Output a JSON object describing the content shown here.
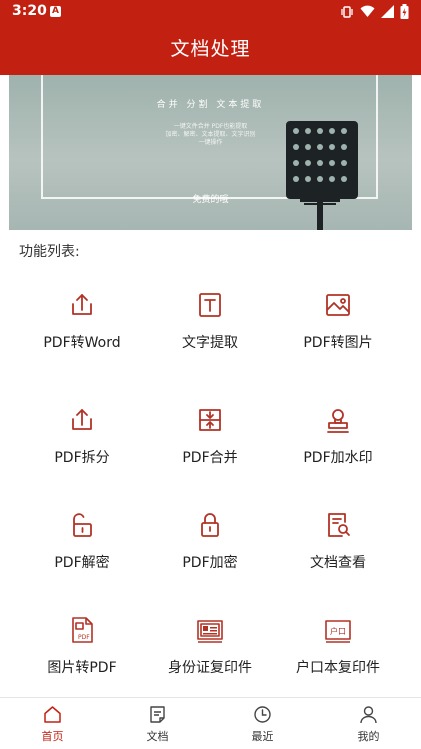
{
  "status_bar": {
    "time": "3:20",
    "badge": "A"
  },
  "app_bar": {
    "title": "文档处理"
  },
  "banner": {
    "headline": "合并 分割 文本提取",
    "desc_line1": "一键文件合并 PDF也能提取",
    "desc_line2": "加密、解密、文本提取、文字识别",
    "desc_line3": "一键操作",
    "free_label": "免费的哦"
  },
  "section": {
    "title": "功能列表:"
  },
  "features": [
    {
      "label": "PDF转Word",
      "icon": "upload-icon"
    },
    {
      "label": "文字提取",
      "icon": "text-icon"
    },
    {
      "label": "PDF转图片",
      "icon": "image-icon"
    },
    {
      "label": "PDF拆分",
      "icon": "split-icon"
    },
    {
      "label": "PDF合并",
      "icon": "merge-icon"
    },
    {
      "label": "PDF加水印",
      "icon": "stamp-icon"
    },
    {
      "label": "PDF解密",
      "icon": "unlock-icon"
    },
    {
      "label": "PDF加密",
      "icon": "lock-icon"
    },
    {
      "label": "文档查看",
      "icon": "doc-search-icon"
    },
    {
      "label": "图片转PDF",
      "icon": "pdf-file-icon"
    },
    {
      "label": "身份证复印件",
      "icon": "id-card-icon"
    },
    {
      "label": "户口本复印件",
      "icon": "household-icon"
    }
  ],
  "bottom_nav": [
    {
      "label": "首页",
      "icon": "home-icon",
      "active": true
    },
    {
      "label": "文档",
      "icon": "document-icon",
      "active": false
    },
    {
      "label": "最近",
      "icon": "clock-icon",
      "active": false
    },
    {
      "label": "我的",
      "icon": "user-icon",
      "active": false
    }
  ],
  "colors": {
    "brand": "#c22112",
    "icon": "#b23326"
  }
}
